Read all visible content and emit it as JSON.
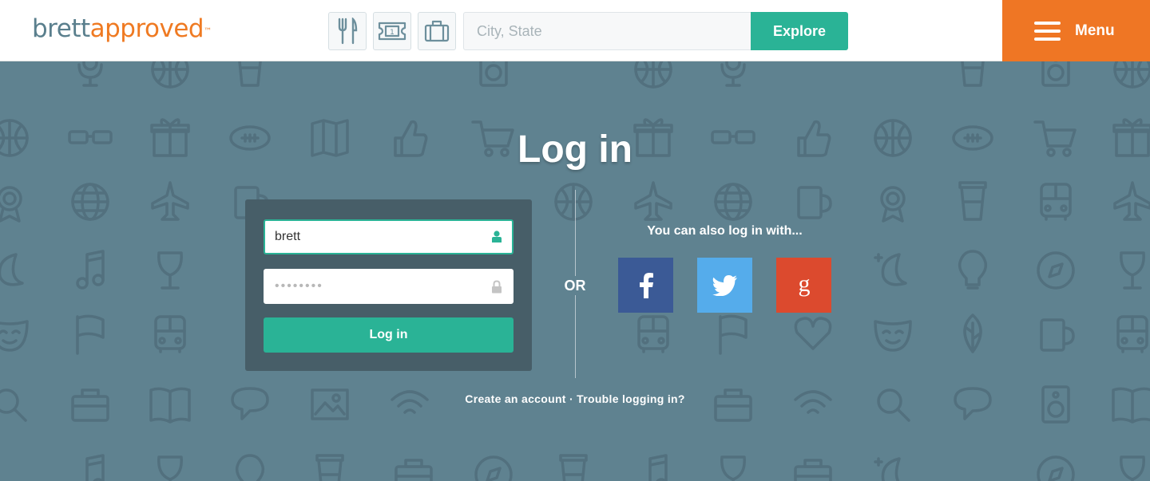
{
  "header": {
    "logo_brett": "brett",
    "logo_approved": "approved",
    "logo_tm": "™",
    "categories": [
      "fork-knife-icon",
      "ticket-icon",
      "suitcase-icon"
    ],
    "search_placeholder": "City, State",
    "explore_label": "Explore",
    "menu_label": "Menu"
  },
  "login": {
    "title": "Log in",
    "username_value": "brett",
    "password_value": "••••••••",
    "submit_label": "Log in",
    "or_label": "OR",
    "social_title": "You can also log in with...",
    "social": [
      {
        "name": "facebook",
        "glyph": "f"
      },
      {
        "name": "twitter",
        "glyph": "twitter-bird-icon"
      },
      {
        "name": "google",
        "glyph": "g"
      }
    ],
    "create_account": "Create an account",
    "separator": "·",
    "trouble": "Trouble logging in?"
  },
  "colors": {
    "brand_teal": "#2ab396",
    "brand_orange": "#ef7624",
    "background": "#5f8290",
    "facebook": "#3b5a96",
    "twitter": "#55aceb",
    "google": "#dc4a2e"
  }
}
